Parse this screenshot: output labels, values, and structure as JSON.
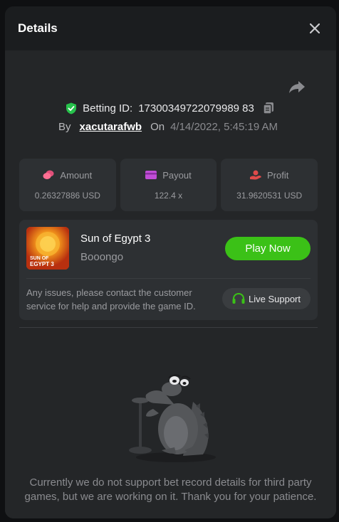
{
  "modal": {
    "title": "Details"
  },
  "bet": {
    "label": "Betting ID:",
    "id": "17300349722079989 83",
    "by_label": "By",
    "username": "xacutarafwb",
    "on_label": "On",
    "datetime": "4/14/2022, 5:45:19 AM"
  },
  "stats": [
    {
      "label": "Amount",
      "value": "0.26327886 USD",
      "icon": "coins-icon"
    },
    {
      "label": "Payout",
      "value": "122.4 x",
      "icon": "card-icon"
    },
    {
      "label": "Profit",
      "value": "31.9620531 USD",
      "icon": "hand-coin-icon"
    }
  ],
  "game": {
    "name": "Sun of Egypt 3",
    "provider": "Booongo",
    "play_label": "Play Now",
    "thumb_text_1": "SUN OF",
    "thumb_text_2": "EGYPT 3"
  },
  "support": {
    "text": "Any issues, please contact the customer service for help and provide the game ID.",
    "button_label": "Live Support"
  },
  "notice": "Currently we do not support bet record details for third party games, but we are working on it. Thank you for your patience.",
  "colors": {
    "accent_green": "#3bc117",
    "shield_green": "#27c24c",
    "amount_icon": "#e0507a",
    "payout_icon": "#c04dd6",
    "profit_icon": "#e04a4a"
  }
}
